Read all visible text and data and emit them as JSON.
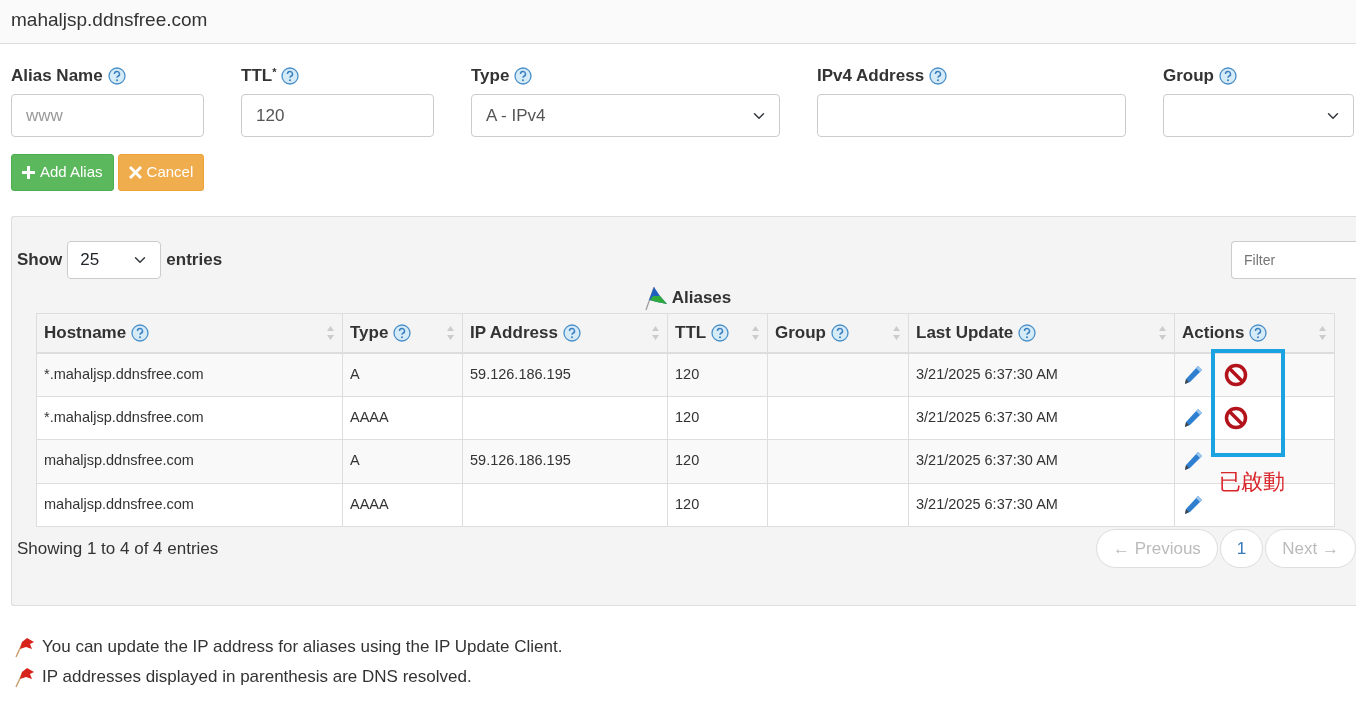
{
  "header": {
    "title": "mahaljsp.ddnsfree.com"
  },
  "form": {
    "fields": [
      {
        "kind": "text",
        "label": "Alias Name",
        "placeholder": "www"
      },
      {
        "kind": "text",
        "label": "TTL$^{*}$",
        "value": "120"
      },
      {
        "kind": "select",
        "label": "Type",
        "value": "A - IPv4"
      },
      {
        "kind": "text",
        "label": "IPv4 Address"
      },
      {
        "kind": "select",
        "label": "Group"
      }
    ],
    "buttons": [
      {
        "kind": "add",
        "label": "Add Alias"
      },
      {
        "kind": "cancel",
        "label": "Cancel"
      }
    ]
  },
  "table_panel": {
    "show_label": "Show",
    "page_length": "25",
    "entries_label": "entries",
    "filter": {
      "placeholder": "Filter"
    },
    "title": "Aliases",
    "columns": [
      "Hostname",
      "Type",
      "IP Address",
      "TTL",
      "Group",
      "Last Update",
      "Actions"
    ],
    "rows": [
      {
        "hostname": "*.mahaljsp.ddnsfree.com",
        "type": "A",
        "ip_address": "59.126.186.195",
        "ttl": "120",
        "last_update": "3/21/2025 6:37:30 AM",
        "blocked": true
      },
      {
        "hostname": "*.mahaljsp.ddnsfree.com",
        "type": "AAAA",
        "ttl": "120",
        "last_update": "3/21/2025 6:37:30 AM",
        "blocked": true
      },
      {
        "hostname": "mahaljsp.ddnsfree.com",
        "type": "A",
        "ip_address": "59.126.186.195",
        "ttl": "120",
        "last_update": "3/21/2025 6:37:30 AM",
        "blocked": false
      },
      {
        "hostname": "mahaljsp.ddnsfree.com",
        "type": "AAAA",
        "ttl": "120",
        "last_update": "3/21/2025 6:37:30 AM",
        "blocked": false
      }
    ],
    "info": "Showing 1 to 4 of 4 entries",
    "pagination": {
      "previous": {
        "label": "← Previous",
        "disabled": true
      },
      "pages": [
        {
          "label": "1",
          "selected": true
        }
      ],
      "next": {
        "label": "Next →",
        "disabled": true
      }
    }
  },
  "notes": [
    "You can update the IP address for aliases using the IP Update Client.",
    "IP addresses displayed in parenthesis are DNS resolved."
  ],
  "annotation": {
    "text": "已啟動"
  }
}
